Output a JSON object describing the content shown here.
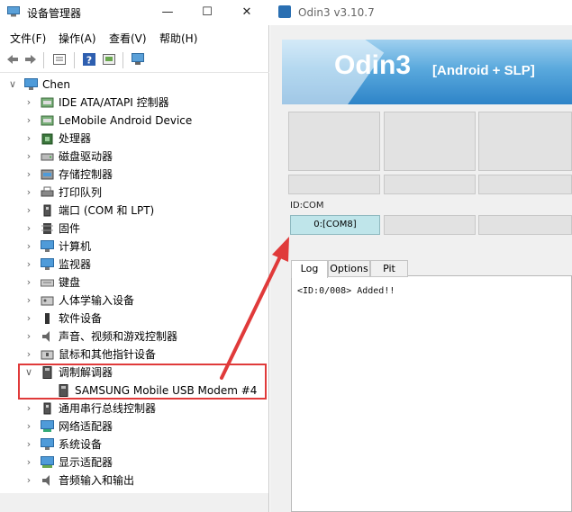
{
  "device_manager": {
    "title": "设备管理器",
    "window_controls": [
      "—",
      "☐",
      "✕"
    ],
    "menu": [
      "文件(F)",
      "操作(A)",
      "查看(V)",
      "帮助(H)"
    ],
    "tree": {
      "root": "Chen",
      "categories": [
        {
          "label": "IDE ATA/ATAPI 控制器",
          "icon": "ide-controller-icon",
          "expanded": false
        },
        {
          "label": "LeMobile Android Device",
          "icon": "android-device-icon",
          "expanded": false
        },
        {
          "label": "处理器",
          "icon": "processor-icon",
          "expanded": false
        },
        {
          "label": "磁盘驱动器",
          "icon": "disk-drive-icon",
          "expanded": false
        },
        {
          "label": "存储控制器",
          "icon": "storage-controller-icon",
          "expanded": false
        },
        {
          "label": "打印队列",
          "icon": "printer-icon",
          "expanded": false
        },
        {
          "label": "端口 (COM 和 LPT)",
          "icon": "port-icon",
          "expanded": false
        },
        {
          "label": "固件",
          "icon": "firmware-icon",
          "expanded": false
        },
        {
          "label": "计算机",
          "icon": "computer-icon",
          "expanded": false
        },
        {
          "label": "监视器",
          "icon": "monitor-icon",
          "expanded": false
        },
        {
          "label": "键盘",
          "icon": "keyboard-icon",
          "expanded": false
        },
        {
          "label": "人体学输入设备",
          "icon": "hid-icon",
          "expanded": false
        },
        {
          "label": "软件设备",
          "icon": "software-device-icon",
          "expanded": false
        },
        {
          "label": "声音、视频和游戏控制器",
          "icon": "sound-icon",
          "expanded": false
        },
        {
          "label": "鼠标和其他指针设备",
          "icon": "mouse-icon",
          "expanded": false
        },
        {
          "label": "调制解调器",
          "icon": "modem-icon",
          "expanded": true,
          "children": [
            {
              "label": "SAMSUNG Mobile USB Modem #4",
              "icon": "modem-icon"
            }
          ]
        },
        {
          "label": "通用串行总线控制器",
          "icon": "usb-icon",
          "expanded": false
        },
        {
          "label": "网络适配器",
          "icon": "network-adapter-icon",
          "expanded": false
        },
        {
          "label": "系统设备",
          "icon": "system-device-icon",
          "expanded": false
        },
        {
          "label": "显示适配器",
          "icon": "display-adapter-icon",
          "expanded": false
        },
        {
          "label": "音频输入和输出",
          "icon": "audio-io-icon",
          "expanded": false
        }
      ]
    }
  },
  "odin": {
    "title": "Odin3 v3.10.7",
    "banner_main": "Odin3",
    "banner_sub": "[Android + SLP]",
    "id_com_label": "ID:COM",
    "com_slots": [
      "0:[COM8]",
      "",
      ""
    ],
    "tabs": [
      "Log",
      "Options",
      "Pit"
    ],
    "active_tab": "Log",
    "log_lines": [
      "<ID:0/008> Added!!"
    ]
  },
  "colors": {
    "annotation_red": "#e03a3a",
    "com_active": "#bfe5ea",
    "banner_blue": "#2e84c8"
  }
}
